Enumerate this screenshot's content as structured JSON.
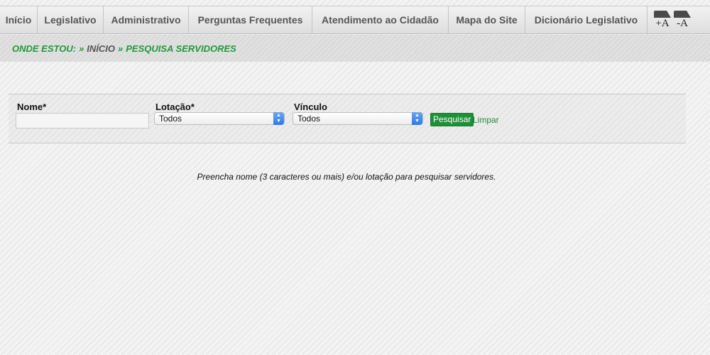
{
  "nav": {
    "items": [
      {
        "label": "Início"
      },
      {
        "label": "Legislativo"
      },
      {
        "label": "Administrativo"
      },
      {
        "label": "Perguntas Frequentes"
      },
      {
        "label": "Atendimento ao Cidadão"
      },
      {
        "label": "Mapa do Site"
      },
      {
        "label": "Dicionário Legislativo"
      }
    ],
    "font_increase": "+A",
    "font_decrease": "-A"
  },
  "breadcrumb": {
    "prefix": "ONDE ESTOU:",
    "separator": "»",
    "home": "INÍCIO",
    "current": "PESQUISA SERVIDORES"
  },
  "search": {
    "name_label": "Nome*",
    "name_value": "",
    "lotacao_label": "Lotação*",
    "lotacao_selected": "Todos",
    "vinculo_label": "Vínculo",
    "vinculo_selected": "Todos",
    "submit_label": "Pesquisar",
    "clear_label": "Limpar"
  },
  "message": "Preencha nome (3 caracteres ou mais) e/ou lotação para pesquisar servidores.",
  "colors": {
    "accent_green": "#1f9a3a",
    "button_green": "#1f8f38"
  }
}
